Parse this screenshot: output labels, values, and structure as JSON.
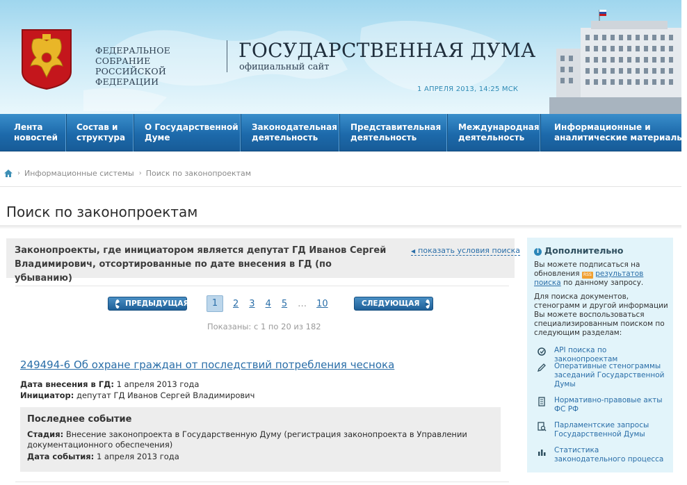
{
  "header": {
    "fed_line1": "ФЕДЕРАЛЬНОЕ СОБРАНИЕ",
    "fed_line2": "РОССИЙСКОЙ ФЕДЕРАЦИИ",
    "site_title": "ГОСУДАРСТВЕННАЯ ДУМА",
    "site_subtitle": "официальный сайт",
    "datetime": "1 АПРЕЛЯ 2013, 14:25 МСК"
  },
  "nav": {
    "items": [
      {
        "line1": "Лента",
        "line2": "новостей"
      },
      {
        "line1": "Состав и",
        "line2": "структура"
      },
      {
        "line1": "О Государственной",
        "line2": "Думе"
      },
      {
        "line1": "Законодательная",
        "line2": "деятельность"
      },
      {
        "line1": "Представительная",
        "line2": "деятельность"
      },
      {
        "line1": "Международная",
        "line2": "деятельность"
      },
      {
        "line1": "Информационные и",
        "line2": "аналитические материалы"
      }
    ]
  },
  "breadcrumb": {
    "items": [
      "Информационные системы",
      "Поиск по законопроектам"
    ]
  },
  "page_title": "Поиск по законопроектам",
  "summary": {
    "text": "Законопроекты, где инициатором является депутат ГД Иванов Сергей Владимирович, отсортированные по дате внесения в ГД (по убыванию)",
    "show_conditions": "показать условия поиска"
  },
  "pagination": {
    "prev_label": "ПРЕДЫДУЩАЯ",
    "next_label": "СЛЕДУЮЩАЯ",
    "pages": [
      "1",
      "2",
      "3",
      "4",
      "5"
    ],
    "ellipsis": "…",
    "last": "10",
    "shown_text": "Показаны: с 1 по 20 из 182"
  },
  "bill": {
    "title": "249494-6 Об охране граждан от последствий потребления чеснока",
    "date_label": "Дата внесения в ГД:",
    "date_value": "1 апреля 2013 года",
    "initiator_label": "Инициатор:",
    "initiator_value": "депутат ГД Иванов Сергей Владимирович",
    "last_event": {
      "heading": "Последнее событие",
      "stage_label": "Стадия:",
      "stage_value": "Внесение законопроекта в Государственную Думу (регистрация законопроекта в Управлении документационного обеспечения)",
      "date_label": "Дата события:",
      "date_value": "1 апреля 2013 года"
    }
  },
  "sidebar": {
    "heading": "Дополнительно",
    "p1_before": "Вы можете подписаться на обновления",
    "rss_badge": "RSS",
    "p1_link": "результатов поиска",
    "p1_after": "по данному запросу.",
    "p2": "Для поиска документов, стенограмм и другой информации Вы можете воспользоваться специализированным поиском по следующим разделам:",
    "links": [
      {
        "icon": "api-search-icon",
        "label": "API поиска по законопроектам"
      },
      {
        "icon": "pen-icon",
        "label": "Оперативные стенограммы заседаний Государственной Думы"
      },
      {
        "icon": "document-icon",
        "label": "Нормативно-правовые акты ФС РФ"
      },
      {
        "icon": "document-search-icon",
        "label": "Парламентские запросы Государственной Думы"
      },
      {
        "icon": "bar-chart-icon",
        "label": "Статистика законодательного процесса"
      }
    ]
  }
}
